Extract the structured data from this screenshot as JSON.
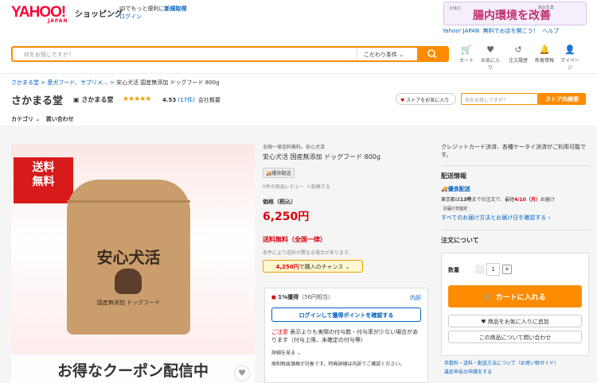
{
  "header": {
    "logo": "YAHOO!",
    "logo_sub": "JAPAN",
    "service": "ショッピング",
    "promo_line1": "IDでもっと便利に",
    "promo_register": "新規取得",
    "promo_login": "ログイン",
    "banner_small": "大味の",
    "banner_text": "腸内環境を改善",
    "banner_brand": "森永乳業",
    "top_links": [
      "Yahoo! JAPAN",
      "無料でお店を開こう！",
      "ヘルプ"
    ]
  },
  "search": {
    "placeholder": "何をお探しですか？",
    "condition_label": "こだわり条件",
    "search_icon": "search-icon"
  },
  "user_icons": [
    {
      "label": "カート",
      "icon": "cart-icon"
    },
    {
      "label": "お気に入り",
      "icon": "heart-icon"
    },
    {
      "label": "注文履歴",
      "icon": "history-icon"
    },
    {
      "label": "新着情報",
      "icon": "bell-icon"
    },
    {
      "label": "マイページ",
      "icon": "user-icon"
    }
  ],
  "breadcrumb": [
    "さかまる堂",
    "愛犬フード、サプリメ...",
    "安心犬活 国産無添加 ドッグフード 800g"
  ],
  "store": {
    "name": "さかまる堂",
    "badge": "さかまる堂",
    "stars": "★★★★★",
    "rating": "4.53",
    "rating_count": "(17件)",
    "company": "会社概要",
    "fav_label": "ストアをお気に入り",
    "search_placeholder": "何をお探しですか？",
    "search_button": "ストア内検索"
  },
  "nav": {
    "category": "カテゴリ",
    "inquiry": "買い合わせ"
  },
  "image": {
    "free_ship_badge": "送料\n無料",
    "bag_title": "安心犬活",
    "bag_subtitle": "国産無添加 ドッグフード",
    "coupon_text": "お得なクーポン配信中"
  },
  "product": {
    "tagline": "全国一律送料無料。安心犬活",
    "title": "安心犬活 国産無添加 ドッグフード 800g",
    "badge": "優良配送",
    "review": "0件の商品レビュー",
    "report": "投稿する",
    "price_label": "価格（税込）",
    "price": "6,250円",
    "shipping": "送料無料（全国一律）",
    "ship_note": "条件により送料が異なる場合があります。",
    "chance_amount": "4,250円",
    "chance_text": "で購入のチャンス"
  },
  "points": {
    "title": "1%獲得",
    "detail": "（56円相当）",
    "breakdown": "内訳",
    "login_button": "ログインして獲得ポイントを確認する",
    "warn_label": "ご注意",
    "warn_text": "表示よりも実際の付与数・付与率が少ない場合があります（付与上限、未確定の付与等）",
    "more": "詳細を見る",
    "tax_note": "原則税抜価格が対象です。特典詳細は内訳でご確認ください。"
  },
  "right": {
    "payment_note": "クレジットカード決済、各種ケータイ決済がご利用可能です。",
    "delivery_head": "配送情報",
    "delivery_tag": "優良配送",
    "delivery_line_prefix": "東京都は",
    "delivery_time": "13時",
    "delivery_mid": "までの注文で、最短",
    "delivery_date": "4/10（月）",
    "delivery_suffix": "お届け",
    "delivery_chip": "お届け日指定",
    "delivery_link": "すべてのお届け方法とお届け日を確認する",
    "order_head": "注文について",
    "qty_label": "数量",
    "qty_value": "1",
    "cart_button": "カートに入れる",
    "fav_button": "商品をお気に入りに追加",
    "ask_button": "この商品について問い合わせ",
    "bottom_link1": "手数料・送料・配送方法について（お買い物ガイド）",
    "bottom_link2": "違反申告の申請をする"
  }
}
